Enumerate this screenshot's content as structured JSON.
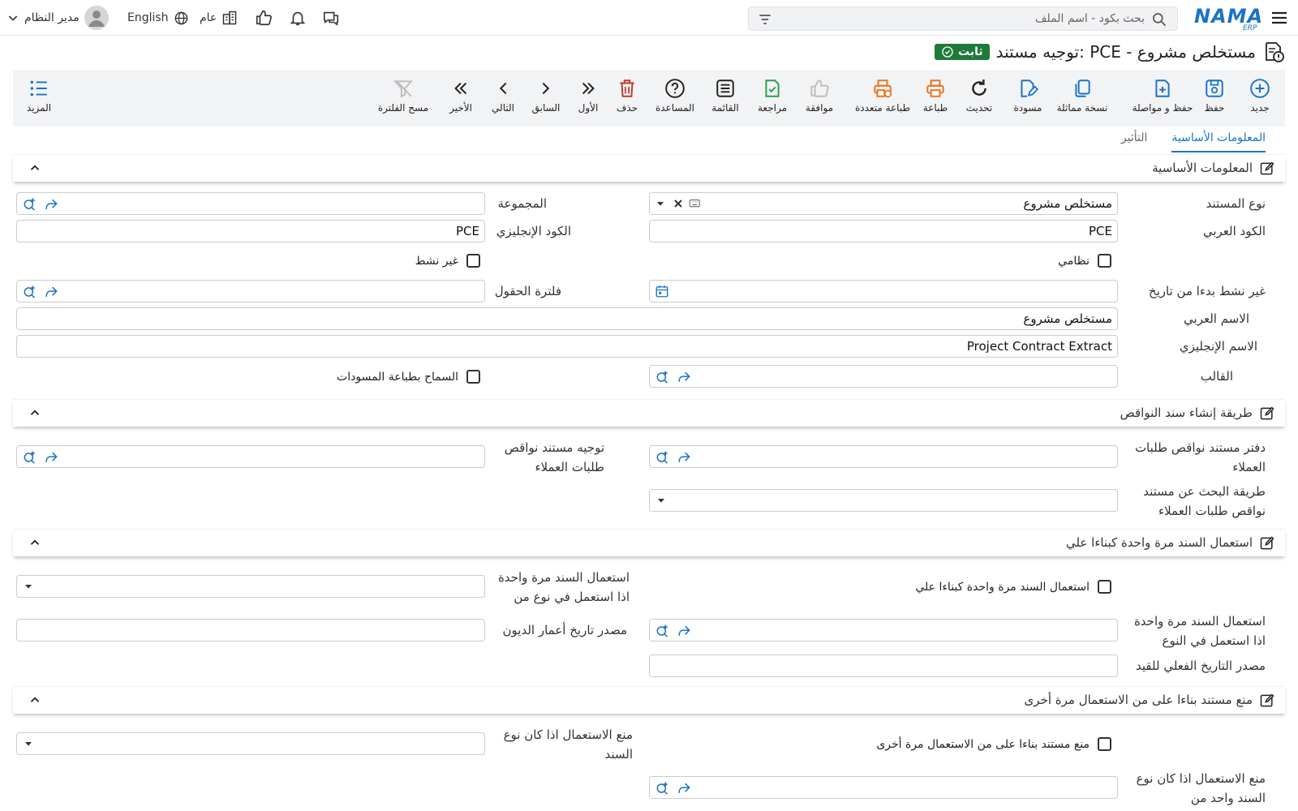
{
  "topbar": {
    "search_placeholder": "بحث بكود - اسم الملف",
    "language": "English",
    "branch": "عام",
    "user": "مدير النظام",
    "logo_text": "NAMA",
    "logo_sub": "ERP"
  },
  "page": {
    "title": "توجيه مستند: PCE - مستخلص مشروع",
    "status_badge": "ثابت"
  },
  "toolbar": {
    "new": "جديد",
    "save": "حفظ",
    "save_continue": "حفظ و مواصلة",
    "duplicate": "نسخة مماثلة",
    "draft": "مسودة",
    "refresh": "تحديث",
    "print": "طباعة",
    "multi_print": "طباعة متعددة",
    "approve": "موافقة",
    "review": "مراجعة",
    "list": "القائمة",
    "help": "المساعدة",
    "delete": "حذف",
    "first": "الأول",
    "previous": "السابق",
    "next": "التالي",
    "last": "الأخير",
    "clear_filter": "مسح الفلترة",
    "more": "المزيد"
  },
  "tabs": {
    "basic": "المعلومات الأساسية",
    "effect": "التأثير"
  },
  "sections": {
    "basic": "المعلومات الأساسية",
    "shortage": "طريقة إنشاء سند النواقص",
    "use_once": "استعمال السند مرة واحدة كبناءا علي",
    "prevent": "منع مستند بناءا على من الاستعمال مرة أخرى"
  },
  "basic": {
    "doc_type_label": "نوع المستند",
    "doc_type_value": "مستخلص مشروع",
    "group_label": "المجموعة",
    "arabic_code_label": "الكود العربي",
    "arabic_code_value": "PCE",
    "english_code_label": "الكود الإنجليزي",
    "english_code_value": "PCE",
    "system_label": "نظامي",
    "inactive_label": "غير نشط",
    "inactive_from_label": "غير نشط بدءا من تاريخ",
    "fields_filter_label": "فلترة الحقول",
    "arabic_name_label": "الاسم العربي",
    "arabic_name_value": "مستخلص مشروع",
    "english_name_label": "الاسم الإنجليزي",
    "english_name_value": "Project Contract Extract",
    "template_label": "القالب",
    "allow_draft_print_label": "السماح بطباعة المسودات"
  },
  "shortage": {
    "book_label_1": "دفتر مستند نواقص طلبات",
    "book_label_2": "العملاء",
    "route_label_1": "توجيه مستند نواقص",
    "route_label_2": "طلبات العملاء",
    "search_label_1": "طريقة البحث عن مستند",
    "search_label_2": "نواقص طلبات العملاء"
  },
  "use_once": {
    "checkbox_label": "استعمال السند مرة واحدة كبناءا علي",
    "if_used_in_type_from_1": "استعمال السند مرة واحدة",
    "if_used_in_type_from_2": "اذا استعمل في نوع من",
    "if_used_in_type_1": "استعمال السند مرة واحدة",
    "if_used_in_type_2": "اذا استعمل في النوع",
    "debt_age_source_label": "مصدر تاريخ أعمار الديون",
    "actual_date_source_label": "مصدر التاريخ الفعلي للقيد"
  },
  "prevent": {
    "checkbox_label": "منع مستند بناءا على من الاستعمال مرة أخرى",
    "prevent_if_type_1": "منع الاستعمال اذا كان نوع",
    "prevent_if_type_2": "السند",
    "prevent_if_one_1": "منع الاستعمال اذا كان نوع",
    "prevent_if_one_2": "السند واحد من"
  },
  "colors": {
    "accent": "#1a73c9",
    "badge": "#1f7a3a",
    "print_orange": "#e8731c",
    "green_icon": "#2a9d4a",
    "delete_red": "#c0392b"
  }
}
